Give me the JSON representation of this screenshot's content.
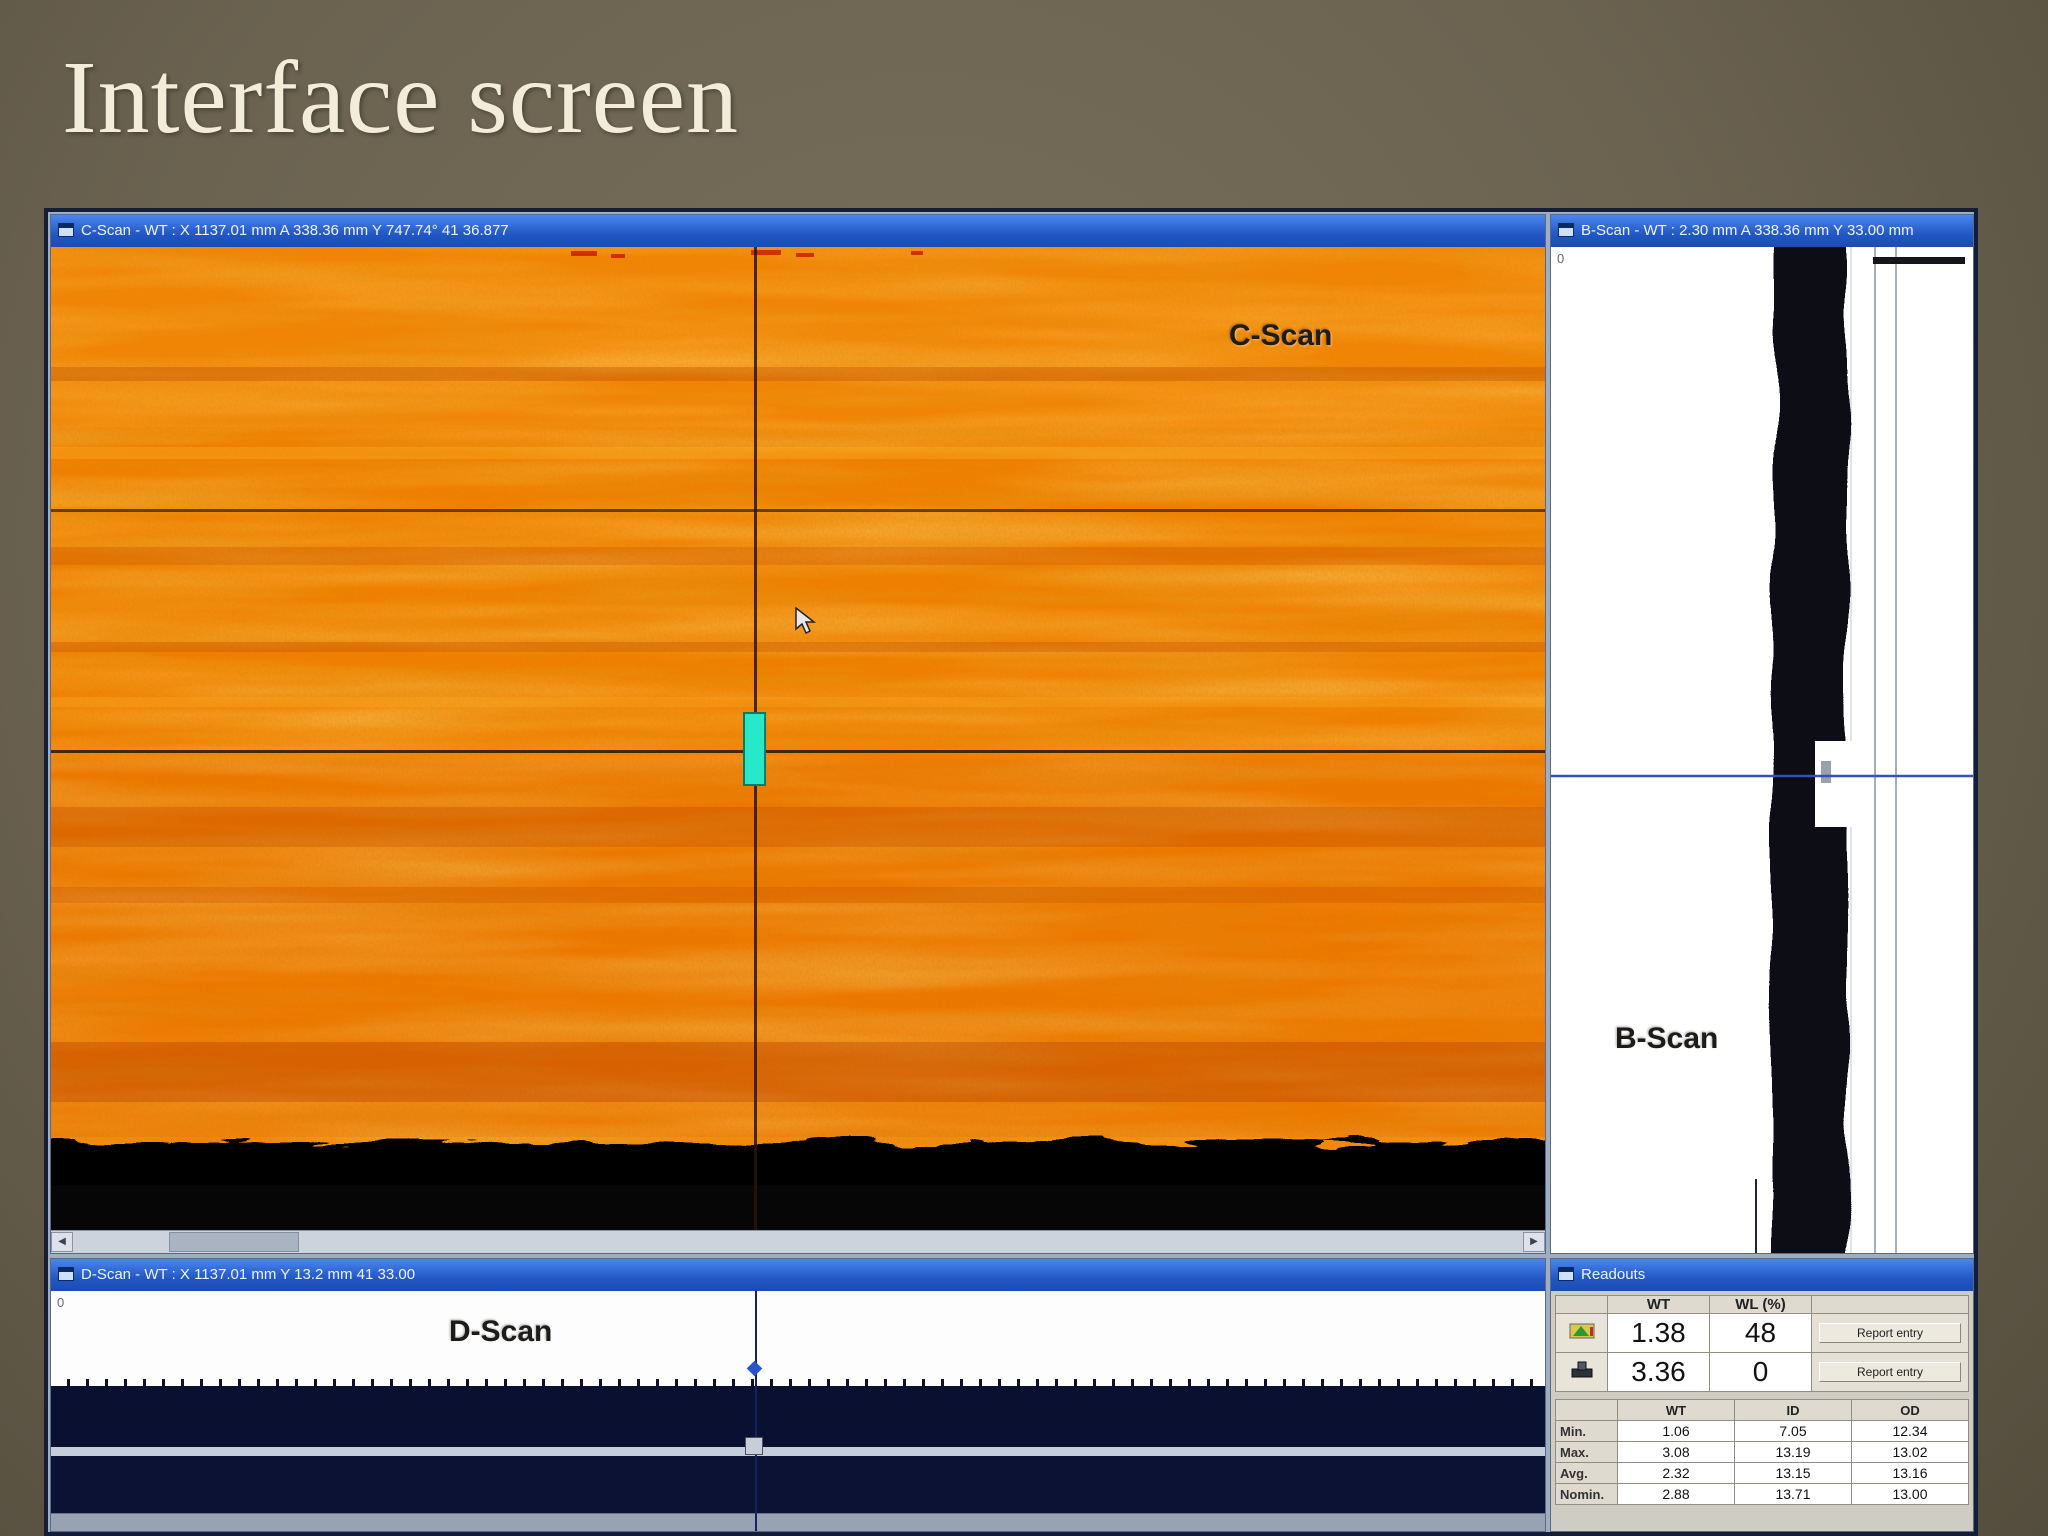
{
  "slide": {
    "title": "Interface screen"
  },
  "colors": {
    "titlebar_blue": "#2257c4",
    "cscan_orange": "#f08000",
    "backwall_black": "#070709",
    "dscan_navy": "#0a1130"
  },
  "cscan": {
    "titlebar": "C-Scan - WT : X 1137.01 mm  A 338.36 mm  Y 747.74°  41 36.877",
    "label": "C-Scan"
  },
  "bscan": {
    "titlebar": "B-Scan - WT : 2.30 mm  A 338.36 mm  Y 33.00 mm",
    "label": "B-Scan",
    "origin_tick": "0"
  },
  "dscan": {
    "titlebar": "D-Scan - WT : X 1137.01 mm  Y 13.2 mm  41 33.00",
    "label": "D-Scan",
    "origin_tick": "0"
  },
  "readouts": {
    "titlebar": "Readouts",
    "top_table": {
      "col_headers": [
        "WT",
        "WL (%)"
      ],
      "rows": [
        {
          "icon": "gauge-icon",
          "wt": "1.38",
          "wl": "48",
          "action": "Report entry"
        },
        {
          "icon": "probe-icon",
          "wt": "3.36",
          "wl": "0",
          "action": "Report entry"
        }
      ]
    },
    "bottom_table": {
      "col_headers": [
        "WT",
        "ID",
        "OD"
      ],
      "rows": [
        {
          "label": "Min.",
          "wt": "1.06",
          "id": "7.05",
          "od": "12.34"
        },
        {
          "label": "Max.",
          "wt": "3.08",
          "id": "13.19",
          "od": "13.02"
        },
        {
          "label": "Avg.",
          "wt": "2.32",
          "id": "13.15",
          "od": "13.16"
        },
        {
          "label": "Nomin.",
          "wt": "2.88",
          "id": "13.71",
          "od": "13.00"
        }
      ]
    }
  }
}
